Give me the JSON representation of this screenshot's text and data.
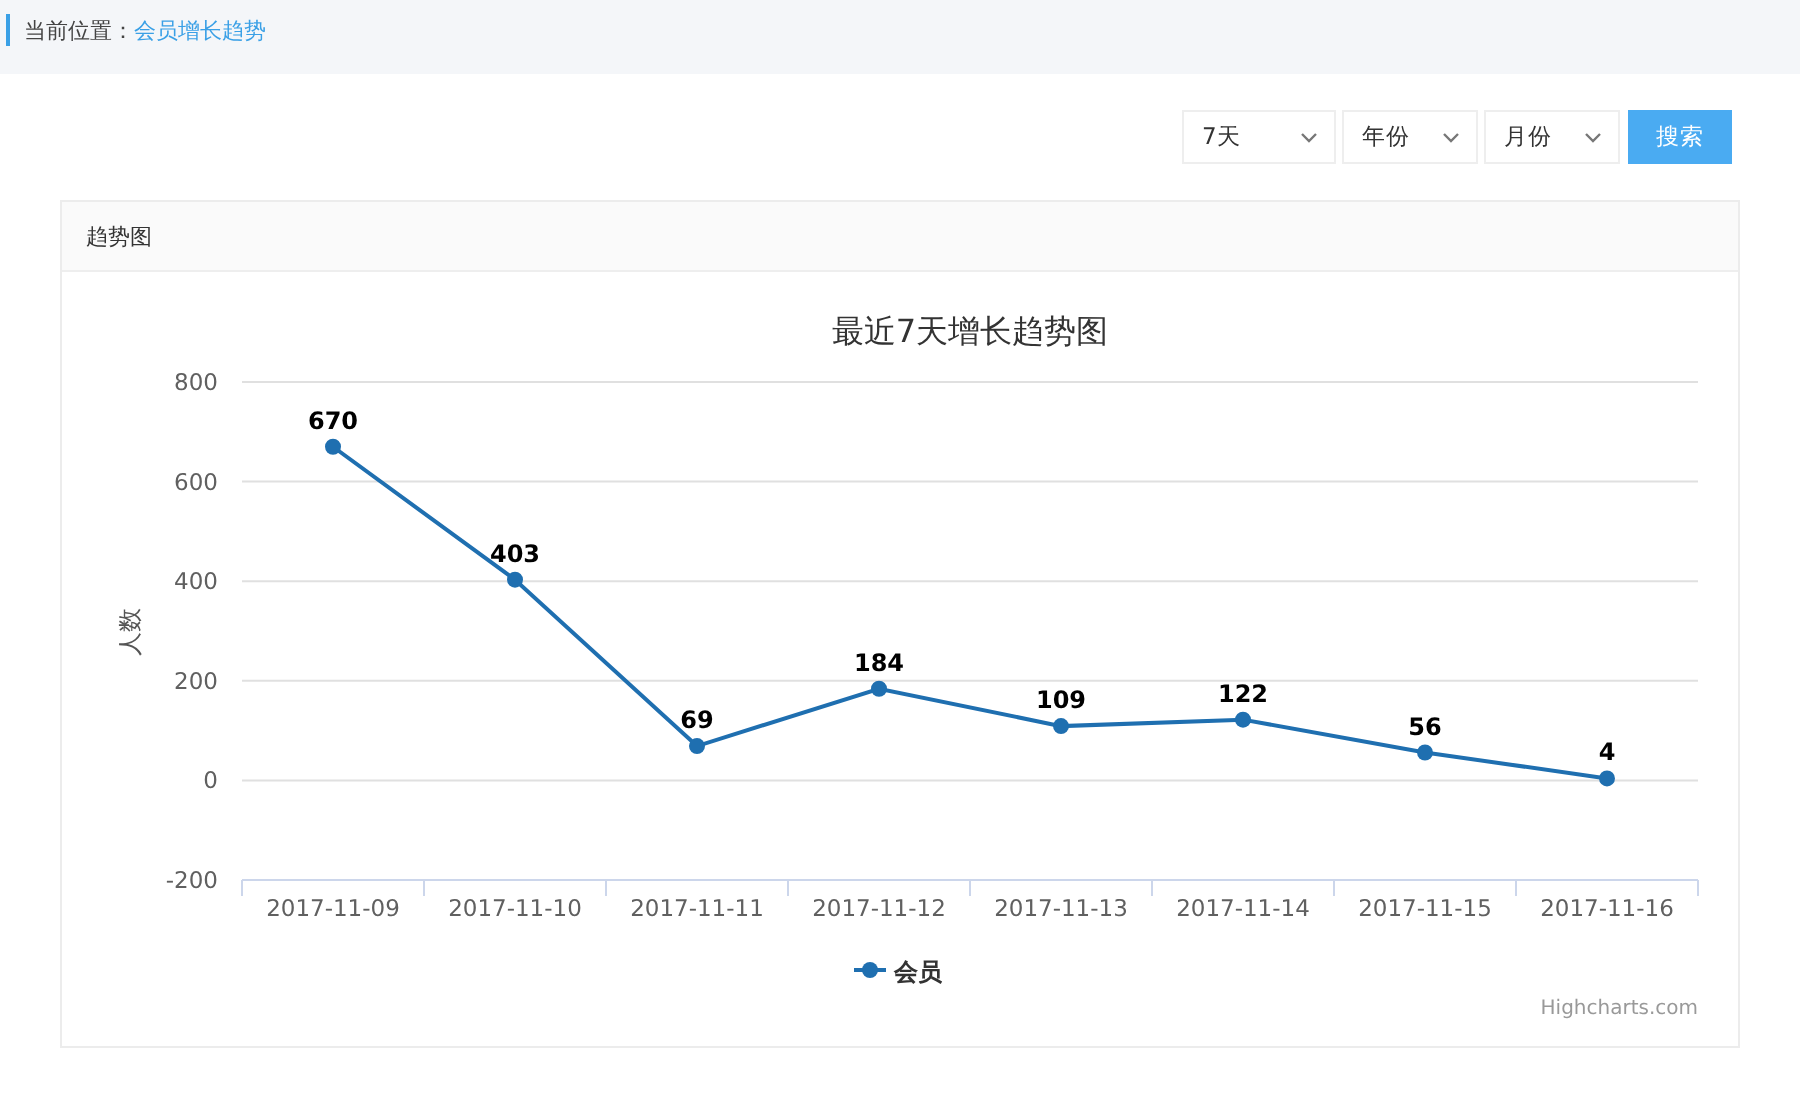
{
  "breadcrumb": {
    "label": "当前位置：",
    "current": "会员增长趋势"
  },
  "filters": [
    {
      "value": "7天"
    },
    {
      "value": "年份"
    },
    {
      "value": "月份"
    }
  ],
  "search_button": "搜索",
  "card": {
    "title": "趋势图",
    "chart_data": {
      "type": "line",
      "title": "最近7天增长趋势图",
      "ylabel": "人数",
      "categories": [
        "2017-11-09",
        "2017-11-10",
        "2017-11-11",
        "2017-11-12",
        "2017-11-13",
        "2017-11-14",
        "2017-11-15",
        "2017-11-16"
      ],
      "series": [
        {
          "name": "会员",
          "color": "#1f6fb0",
          "marker": true,
          "values": [
            670,
            403,
            69,
            184,
            109,
            122,
            56,
            4
          ]
        }
      ],
      "grid": true,
      "ylim": [
        -200,
        800
      ],
      "yticks": [
        -200,
        0,
        200,
        400,
        600,
        800
      ],
      "data_labels": true
    },
    "credits": "Highcharts.com"
  }
}
